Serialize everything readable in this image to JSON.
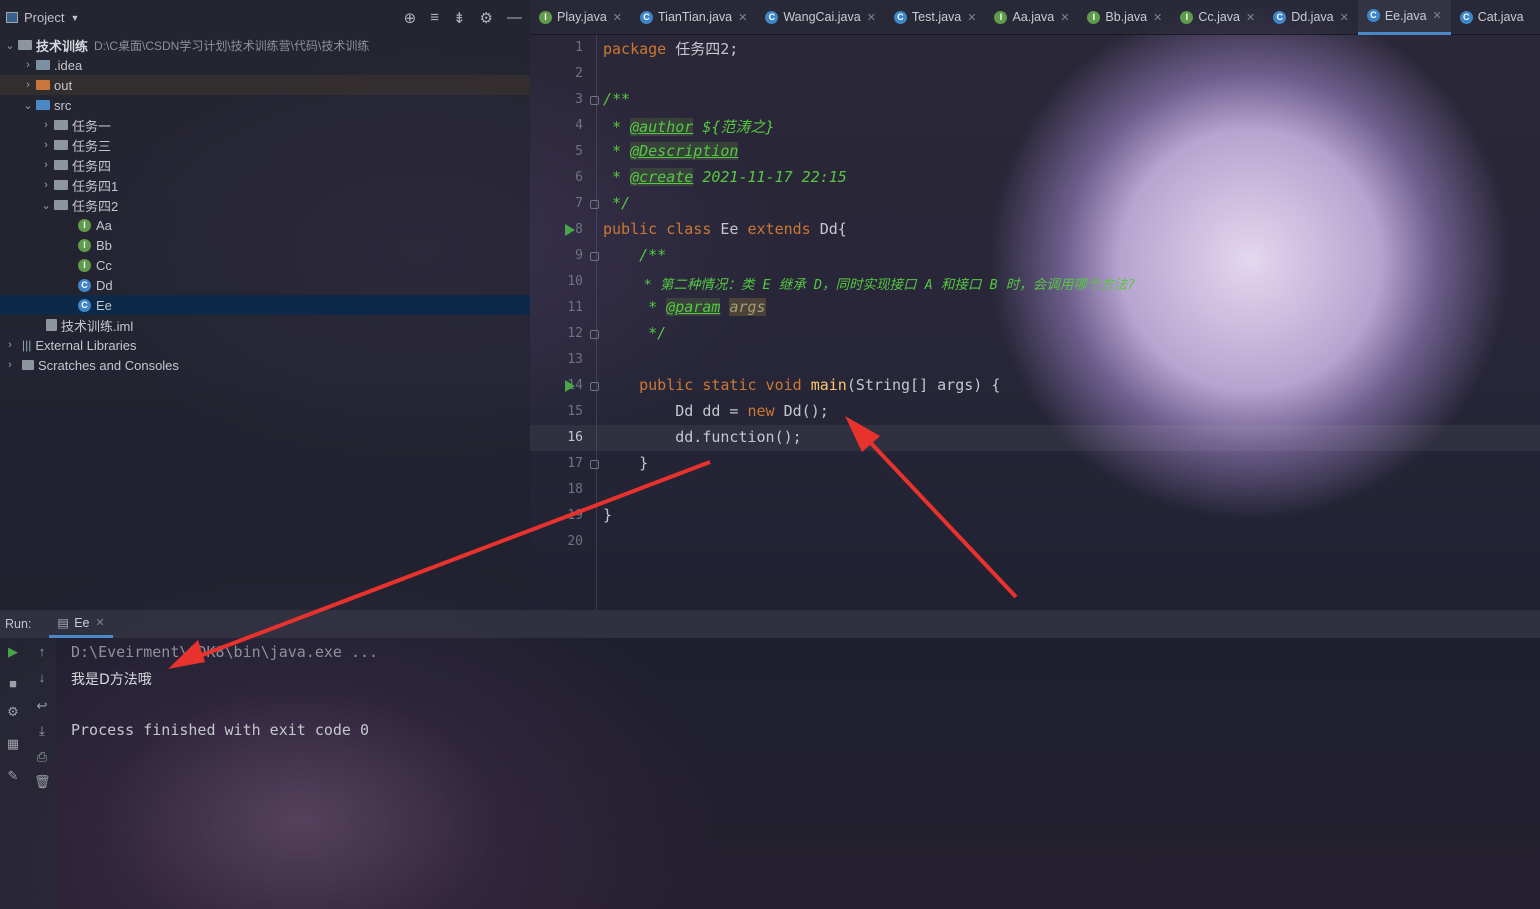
{
  "project": {
    "title": "Project",
    "root_name": "技术训练",
    "root_path": "D:\\C桌面\\CSDN学习计划\\技术训练营\\代码\\技术训练",
    "items": [
      {
        "label": ".idea"
      },
      {
        "label": "out"
      },
      {
        "label": "src"
      },
      {
        "label": "任务一"
      },
      {
        "label": "任务三"
      },
      {
        "label": "任务四"
      },
      {
        "label": "任务四1"
      },
      {
        "label": "任务四2"
      },
      {
        "label": "Aa"
      },
      {
        "label": "Bb"
      },
      {
        "label": "Cc"
      },
      {
        "label": "Dd"
      },
      {
        "label": "Ee"
      },
      {
        "label": "技术训练.iml"
      },
      {
        "label": "External Libraries"
      },
      {
        "label": "Scratches and Consoles"
      }
    ]
  },
  "tabs": [
    {
      "label": "Play.java",
      "icon": "I"
    },
    {
      "label": "TianTian.java",
      "icon": "C"
    },
    {
      "label": "WangCai.java",
      "icon": "C"
    },
    {
      "label": "Test.java",
      "icon": "C"
    },
    {
      "label": "Aa.java",
      "icon": "I"
    },
    {
      "label": "Bb.java",
      "icon": "I"
    },
    {
      "label": "Cc.java",
      "icon": "I"
    },
    {
      "label": "Dd.java",
      "icon": "C"
    },
    {
      "label": "Ee.java",
      "icon": "C"
    },
    {
      "label": "Cat.java",
      "icon": "C"
    }
  ],
  "editor": {
    "line_numbers": [
      "1",
      "2",
      "3",
      "4",
      "5",
      "6",
      "7",
      "8",
      "9",
      "10",
      "11",
      "12",
      "13",
      "14",
      "15",
      "16",
      "17",
      "18",
      "19",
      "20"
    ],
    "current_line": "16",
    "l1_kw": "package",
    "l1_rest": " 任务四2;",
    "l3": "/**",
    "l4_star": " * ",
    "l4_tag": "@author",
    "l4_val": " ${范涛之}",
    "l5_star": " * ",
    "l5_tag": "@Description",
    "l6_star": " * ",
    "l6_tag": "@create",
    "l6_val": " 2021-11-17 22:15",
    "l7": " */",
    "l8_kw1": "public class",
    "l8_name": " Ee ",
    "l8_kw2": "extends",
    "l8_rest": " Dd{",
    "l9": "    /**",
    "l10": "     * 第二种情况：类 E 继承 D，同时实现接口 A 和接口 B 时，会调用哪个方法?",
    "l11_star": "     * ",
    "l11_tag": "@param",
    "l11_arg": "args",
    "l12": "     */",
    "l14_kw": "    public static void ",
    "l14_fn": "main",
    "l14_rest": "(String[] args) {",
    "l15_a": "        Dd dd = ",
    "l15_kw": "new",
    "l15_b": " Dd();",
    "l16": "        dd.function();",
    "l17": "    }",
    "l19": "}"
  },
  "run": {
    "label": "Run:",
    "tab": "Ee",
    "cmd": "D:\\Eveirment\\JDK8\\bin\\java.exe ...",
    "output": "我是D方法哦",
    "finish": "Process finished with exit code 0"
  },
  "colors": {
    "keyword": "#cc7832",
    "doc_comment": "#56c743",
    "method": "#ffc66d",
    "selection": "#0d2947",
    "arrow": "#e8322e"
  }
}
